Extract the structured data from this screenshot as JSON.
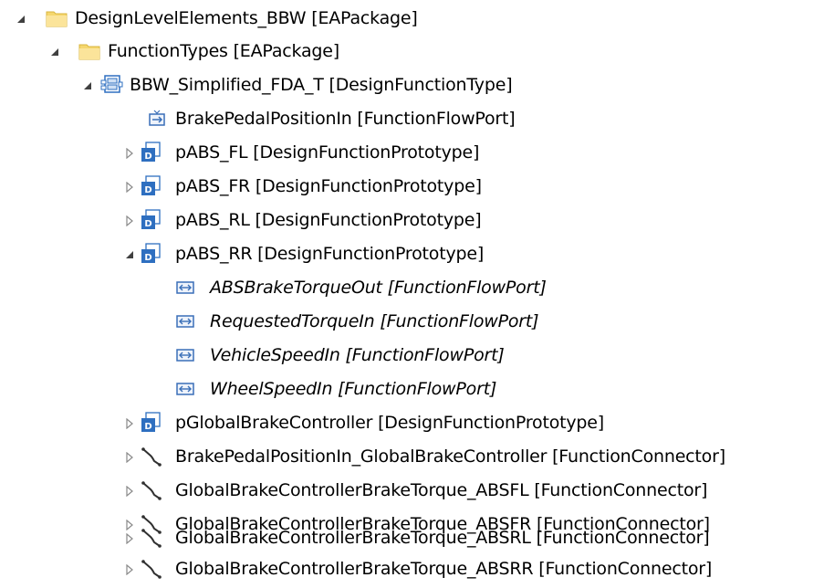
{
  "tree": {
    "root": {
      "label": "DesignLevelElements_BBW [EAPackage]",
      "expanded": true,
      "icon": "folder-icon"
    },
    "function_types": {
      "label": "FunctionTypes [EAPackage]",
      "expanded": true,
      "icon": "folder-icon"
    },
    "design_function_type": {
      "label": "BBW_Simplified_FDA_T [DesignFunctionType]",
      "expanded": true,
      "icon": "design-function-type-icon"
    },
    "children": [
      {
        "label": "BrakePedalPositionIn [FunctionFlowPort]",
        "icon": "flow-port-in-icon",
        "twisty": "none"
      },
      {
        "label": "pABS_FL [DesignFunctionPrototype]",
        "icon": "prototype-icon",
        "twisty": "collapsed"
      },
      {
        "label": "pABS_FR [DesignFunctionPrototype]",
        "icon": "prototype-icon",
        "twisty": "collapsed"
      },
      {
        "label": "pABS_RL [DesignFunctionPrototype]",
        "icon": "prototype-icon",
        "twisty": "collapsed"
      },
      {
        "label": "pABS_RR [DesignFunctionPrototype]",
        "icon": "prototype-icon",
        "twisty": "expanded"
      }
    ],
    "rr_ports": [
      {
        "label": "ABSBrakeTorqueOut [FunctionFlowPort]",
        "icon": "flow-port-icon"
      },
      {
        "label": "RequestedTorqueIn [FunctionFlowPort]",
        "icon": "flow-port-icon"
      },
      {
        "label": "VehicleSpeedIn [FunctionFlowPort]",
        "icon": "flow-port-icon"
      },
      {
        "label": "WheelSpeedIn [FunctionFlowPort]",
        "icon": "flow-port-icon"
      }
    ],
    "more_children": [
      {
        "label": "pGlobalBrakeController [DesignFunctionPrototype]",
        "icon": "prototype-icon",
        "twisty": "collapsed"
      },
      {
        "label": "BrakePedalPositionIn_GlobalBrakeController [FunctionConnector]",
        "icon": "connector-icon",
        "twisty": "collapsed"
      },
      {
        "label": "GlobalBrakeControllerBrakeTorque_ABSFL [FunctionConnector]",
        "icon": "connector-icon",
        "twisty": "collapsed"
      },
      {
        "label": "GlobalBrakeControllerBrakeTorque_ABSFR [FunctionConnector]",
        "icon": "connector-icon",
        "twisty": "collapsed"
      },
      {
        "label": "GlobalBrakeControllerBrakeTorque_ABSRL [FunctionConnector]",
        "icon": "connector-icon",
        "twisty": "collapsed"
      },
      {
        "label": "GlobalBrakeControllerBrakeTorque_ABSRR [FunctionConnector]",
        "icon": "connector-icon",
        "twisty": "collapsed"
      }
    ]
  },
  "colors": {
    "folder": "#f5d76e",
    "folder_dark": "#d9b53e",
    "prototype_blue": "#2e6fc0",
    "port_blue": "#3a6fb8",
    "twisty_gray": "#8a8a8a",
    "twisty_dark": "#404040"
  }
}
